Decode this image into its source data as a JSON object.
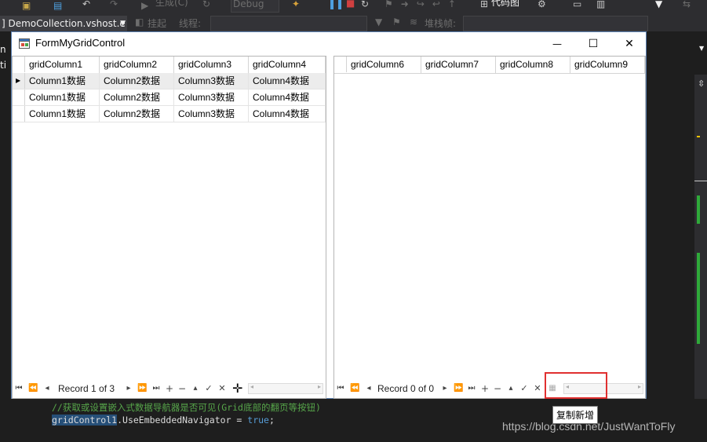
{
  "ide": {
    "tab_title": "] DemoCollection.vshost.e",
    "build_label": "生成(C)",
    "config": "Debug",
    "codemap": "代码图",
    "suspend": "挂起",
    "thread_label": "线程:",
    "stackframe_label": "堆栈帧:",
    "left_label_1": "n",
    "left_label_2": "ti",
    "code_comment": "//获取或设置嵌入式数据导航器是否可见(Grid底部的翻页等按钮)",
    "code_object": "gridControl1",
    "code_member": ".UseEmbeddedNavigator = ",
    "code_value": "true",
    "code_end": ";",
    "watermark": "https://blog.csdn.net/JustWantToFly"
  },
  "window": {
    "title": "FormMyGridControl",
    "minimize": "—",
    "maximize": "☐",
    "close": "✕"
  },
  "grid1": {
    "columns": [
      "gridColumn1",
      "gridColumn2",
      "gridColumn3",
      "gridColumn4"
    ],
    "rows": [
      [
        "Column1数据",
        "Column2数据",
        "Column3数据",
        "Column4数据"
      ],
      [
        "Column1数据",
        "Column2数据",
        "Column3数据",
        "Column4数据"
      ],
      [
        "Column1数据",
        "Column2数据",
        "Column3数据",
        "Column4数据"
      ]
    ],
    "selected_row": 0,
    "record_text": "Record 1 of 3"
  },
  "grid2": {
    "columns": [
      "gridColumn6",
      "gridColumn7",
      "gridColumn8",
      "gridColumn9"
    ],
    "rows": [],
    "record_text": "Record 0 of 0"
  },
  "nav_icons": [
    "first-icon",
    "prev-page-icon",
    "prev-icon",
    "next-icon",
    "next-page-icon",
    "last-icon",
    "append-icon",
    "delete-icon",
    "edit-icon",
    "end-edit-icon",
    "cancel-edit-icon",
    "custom-copy-add-icon"
  ],
  "tooltip": "复制新增",
  "colors": {
    "ide_background": "#2d2d30",
    "selection_highlight": "#e03030",
    "window_border": "#5a7fb0"
  }
}
